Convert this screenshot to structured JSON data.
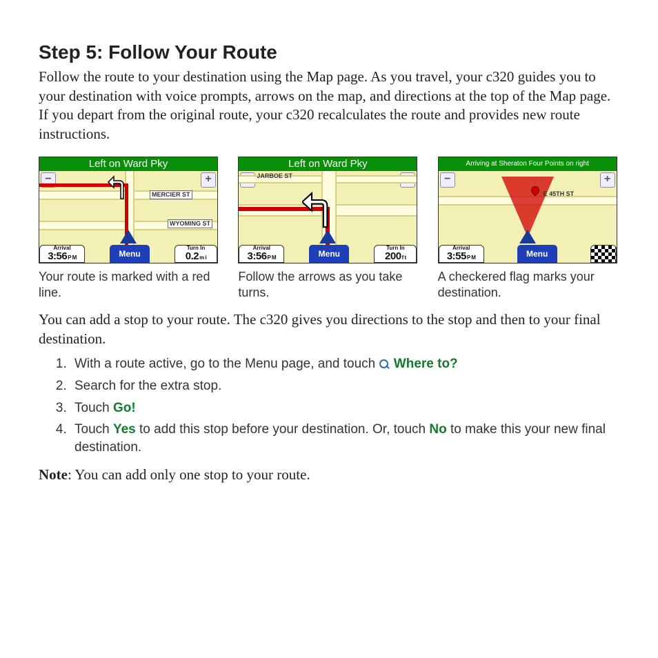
{
  "heading": "Step 5: Follow Your Route",
  "intro": "Follow the route to your destination using the Map page. As you travel, your c320 guides you to your destination with voice prompts, arrows on the map, and directions at the top of the Map page. If you depart from the original route, your c320 recalculates the route and provides new route instructions.",
  "shots": [
    {
      "title": "Left on Ward Pky",
      "streets": [
        "MERCIER ST",
        "WYOMING ST"
      ],
      "arrival_label": "Arrival",
      "arrival_value": "3:56",
      "arrival_suffix": "P M",
      "menu_label": "Menu",
      "turnin_label": "Turn In",
      "turnin_value": "0.2",
      "turnin_suffix": "m i",
      "caption": "Your route is marked with a red line."
    },
    {
      "title": "Left on Ward Pky",
      "streets": [
        "JARBOE ST"
      ],
      "arrival_label": "Arrival",
      "arrival_value": "3:56",
      "arrival_suffix": "P M",
      "menu_label": "Menu",
      "turnin_label": "Turn In",
      "turnin_value": "200",
      "turnin_suffix": "f t",
      "caption": "Follow the arrows as you take turns."
    },
    {
      "title": "Arriving at Sheraton Four Points on right",
      "streets": [
        "E 45TH ST"
      ],
      "arrival_label": "Arrival",
      "arrival_value": "3:55",
      "arrival_suffix": "P M",
      "menu_label": "Menu",
      "caption": "A checkered flag marks your destination."
    }
  ],
  "intro2": "You can add a stop to your route. The c320 gives you directions to the stop and then to your final destination.",
  "steps": {
    "s1_a": "With a route active, go to the Menu page, and touch ",
    "s1_kw": "Where to?",
    "s2": "Search for the extra stop.",
    "s3_a": "Touch ",
    "s3_kw": "Go!",
    "s4_a": "Touch ",
    "s4_kw1": "Yes",
    "s4_b": " to add this stop before your destination. Or, touch ",
    "s4_kw2": "No",
    "s4_c": " to make this your new final destination."
  },
  "note_label": "Note",
  "note_text": ": You can add only one stop to your route."
}
